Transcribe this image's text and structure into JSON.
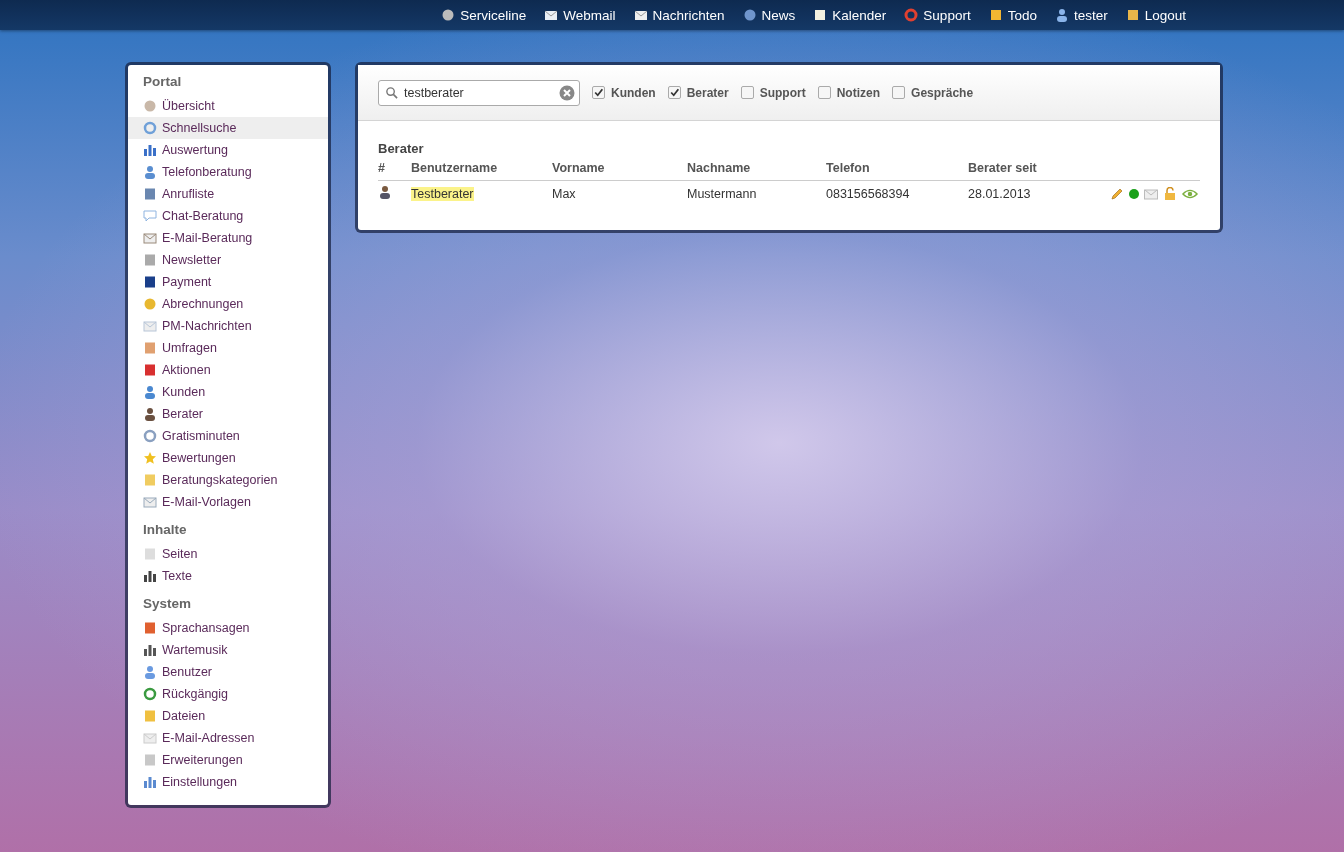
{
  "top_nav": [
    {
      "label": "Serviceline"
    },
    {
      "label": "Webmail"
    },
    {
      "label": "Nachrichten"
    },
    {
      "label": "News"
    },
    {
      "label": "Kalender"
    },
    {
      "label": "Support"
    },
    {
      "label": "Todo"
    },
    {
      "label": "tester"
    },
    {
      "label": "Logout"
    }
  ],
  "sidebar": {
    "sections": [
      {
        "title": "Portal",
        "items": [
          {
            "label": "Übersicht",
            "selected": false
          },
          {
            "label": "Schnellsuche",
            "selected": true
          },
          {
            "label": "Auswertung",
            "selected": false
          },
          {
            "label": "Telefonberatung",
            "selected": false
          },
          {
            "label": "Anrufliste",
            "selected": false
          },
          {
            "label": "Chat-Beratung",
            "selected": false
          },
          {
            "label": "E-Mail-Beratung",
            "selected": false
          },
          {
            "label": "Newsletter",
            "selected": false
          },
          {
            "label": "Payment",
            "selected": false
          },
          {
            "label": "Abrechnungen",
            "selected": false
          },
          {
            "label": "PM-Nachrichten",
            "selected": false
          },
          {
            "label": "Umfragen",
            "selected": false
          },
          {
            "label": "Aktionen",
            "selected": false
          },
          {
            "label": "Kunden",
            "selected": false
          },
          {
            "label": "Berater",
            "selected": false
          },
          {
            "label": "Gratisminuten",
            "selected": false
          },
          {
            "label": "Bewertungen",
            "selected": false
          },
          {
            "label": "Beratungskategorien",
            "selected": false
          },
          {
            "label": "E-Mail-Vorlagen",
            "selected": false
          }
        ]
      },
      {
        "title": "Inhalte",
        "items": [
          {
            "label": "Seiten",
            "selected": false
          },
          {
            "label": "Texte",
            "selected": false
          }
        ]
      },
      {
        "title": "System",
        "items": [
          {
            "label": "Sprachansagen",
            "selected": false
          },
          {
            "label": "Wartemusik",
            "selected": false
          },
          {
            "label": "Benutzer",
            "selected": false
          },
          {
            "label": "Rückgängig",
            "selected": false
          },
          {
            "label": "Dateien",
            "selected": false
          },
          {
            "label": "E-Mail-Adressen",
            "selected": false
          },
          {
            "label": "Erweiterungen",
            "selected": false
          },
          {
            "label": "Einstellungen",
            "selected": false
          }
        ]
      }
    ]
  },
  "search": {
    "value": "testberater",
    "filters": [
      {
        "label": "Kunden",
        "checked": true
      },
      {
        "label": "Berater",
        "checked": true
      },
      {
        "label": "Support",
        "checked": false
      },
      {
        "label": "Notizen",
        "checked": false
      },
      {
        "label": "Gespräche",
        "checked": false
      }
    ]
  },
  "results": {
    "title": "Berater",
    "columns": [
      "#",
      "Benutzername",
      "Vorname",
      "Nachname",
      "Telefon",
      "Berater seit"
    ],
    "rows": [
      {
        "username": "Testberater",
        "first_name": "Max",
        "last_name": "Mustermann",
        "phone": "083156568394",
        "since": "28.01.2013",
        "online": true
      }
    ]
  }
}
